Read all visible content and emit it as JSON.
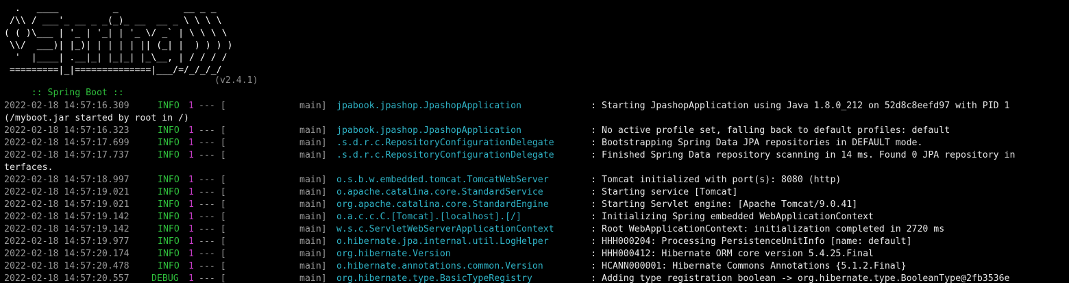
{
  "banner": {
    "art_lines": [
      "  .   ____          _            __ _ _",
      " /\\\\ / ___'_ __ _ _(_)_ __  __ _ \\ \\ \\ \\",
      "( ( )\\___ | '_ | '_| | '_ \\/ _` | \\ \\ \\ \\",
      " \\\\/  ___)| |_)| | | | | || (_| |  ) ) ) )",
      "  '  |____| .__|_| |_|_| |_\\__, | / / / /",
      " =========|_|==============|___/=/_/_/_/"
    ],
    "label": " :: Spring Boot ::",
    "version": "(v2.4.1)"
  },
  "logs": [
    {
      "ts": "2022-02-18 14:57:16.309",
      "level": "INFO",
      "pid": "1",
      "sep": "--- [",
      "thread": "main]",
      "logger": "jpabook.jpashop.JpashopApplication",
      "msg": "Starting JpashopApplication using Java 1.8.0_212 on 52d8c8eefd97 with PID 1"
    },
    {
      "continuation": "(/myboot.jar started by root in /)"
    },
    {
      "ts": "2022-02-18 14:57:16.323",
      "level": "INFO",
      "pid": "1",
      "sep": "--- [",
      "thread": "main]",
      "logger": "jpabook.jpashop.JpashopApplication",
      "msg": "No active profile set, falling back to default profiles: default"
    },
    {
      "ts": "2022-02-18 14:57:17.699",
      "level": "INFO",
      "pid": "1",
      "sep": "--- [",
      "thread": "main]",
      "logger": ".s.d.r.c.RepositoryConfigurationDelegate",
      "msg": "Bootstrapping Spring Data JPA repositories in DEFAULT mode."
    },
    {
      "ts": "2022-02-18 14:57:17.737",
      "level": "INFO",
      "pid": "1",
      "sep": "--- [",
      "thread": "main]",
      "logger": ".s.d.r.c.RepositoryConfigurationDelegate",
      "msg": "Finished Spring Data repository scanning in 14 ms. Found 0 JPA repository in"
    },
    {
      "continuation": "terfaces."
    },
    {
      "ts": "2022-02-18 14:57:18.997",
      "level": "INFO",
      "pid": "1",
      "sep": "--- [",
      "thread": "main]",
      "logger": "o.s.b.w.embedded.tomcat.TomcatWebServer",
      "msg": "Tomcat initialized with port(s): 8080 (http)"
    },
    {
      "ts": "2022-02-18 14:57:19.021",
      "level": "INFO",
      "pid": "1",
      "sep": "--- [",
      "thread": "main]",
      "logger": "o.apache.catalina.core.StandardService",
      "msg": "Starting service [Tomcat]"
    },
    {
      "ts": "2022-02-18 14:57:19.021",
      "level": "INFO",
      "pid": "1",
      "sep": "--- [",
      "thread": "main]",
      "logger": "org.apache.catalina.core.StandardEngine",
      "msg": "Starting Servlet engine: [Apache Tomcat/9.0.41]"
    },
    {
      "ts": "2022-02-18 14:57:19.142",
      "level": "INFO",
      "pid": "1",
      "sep": "--- [",
      "thread": "main]",
      "logger": "o.a.c.c.C.[Tomcat].[localhost].[/]",
      "msg": "Initializing Spring embedded WebApplicationContext"
    },
    {
      "ts": "2022-02-18 14:57:19.142",
      "level": "INFO",
      "pid": "1",
      "sep": "--- [",
      "thread": "main]",
      "logger": "w.s.c.ServletWebServerApplicationContext",
      "msg": "Root WebApplicationContext: initialization completed in 2720 ms"
    },
    {
      "ts": "2022-02-18 14:57:19.977",
      "level": "INFO",
      "pid": "1",
      "sep": "--- [",
      "thread": "main]",
      "logger": "o.hibernate.jpa.internal.util.LogHelper",
      "msg": "HHH000204: Processing PersistenceUnitInfo [name: default]"
    },
    {
      "ts": "2022-02-18 14:57:20.174",
      "level": "INFO",
      "pid": "1",
      "sep": "--- [",
      "thread": "main]",
      "logger": "org.hibernate.Version",
      "msg": "HHH000412: Hibernate ORM core version 5.4.25.Final"
    },
    {
      "ts": "2022-02-18 14:57:20.478",
      "level": "INFO",
      "pid": "1",
      "sep": "--- [",
      "thread": "main]",
      "logger": "o.hibernate.annotations.common.Version",
      "msg": "HCANN000001: Hibernate Commons Annotations {5.1.2.Final}"
    },
    {
      "ts": "2022-02-18 14:57:20.557",
      "level": "DEBUG",
      "pid": "1",
      "sep": "--- [",
      "thread": "main]",
      "logger": "org.hibernate.type.BasicTypeRegistry",
      "msg": "Adding type registration boolean -> org.hibernate.type.BooleanType@2fb3536e"
    }
  ],
  "colors": {
    "background": "#000000",
    "timestamp": "#9a9a9a",
    "level": "#2fbf3c",
    "pid": "#c33cc3",
    "logger": "#2fb3c6",
    "message": "#e6e6e6"
  }
}
